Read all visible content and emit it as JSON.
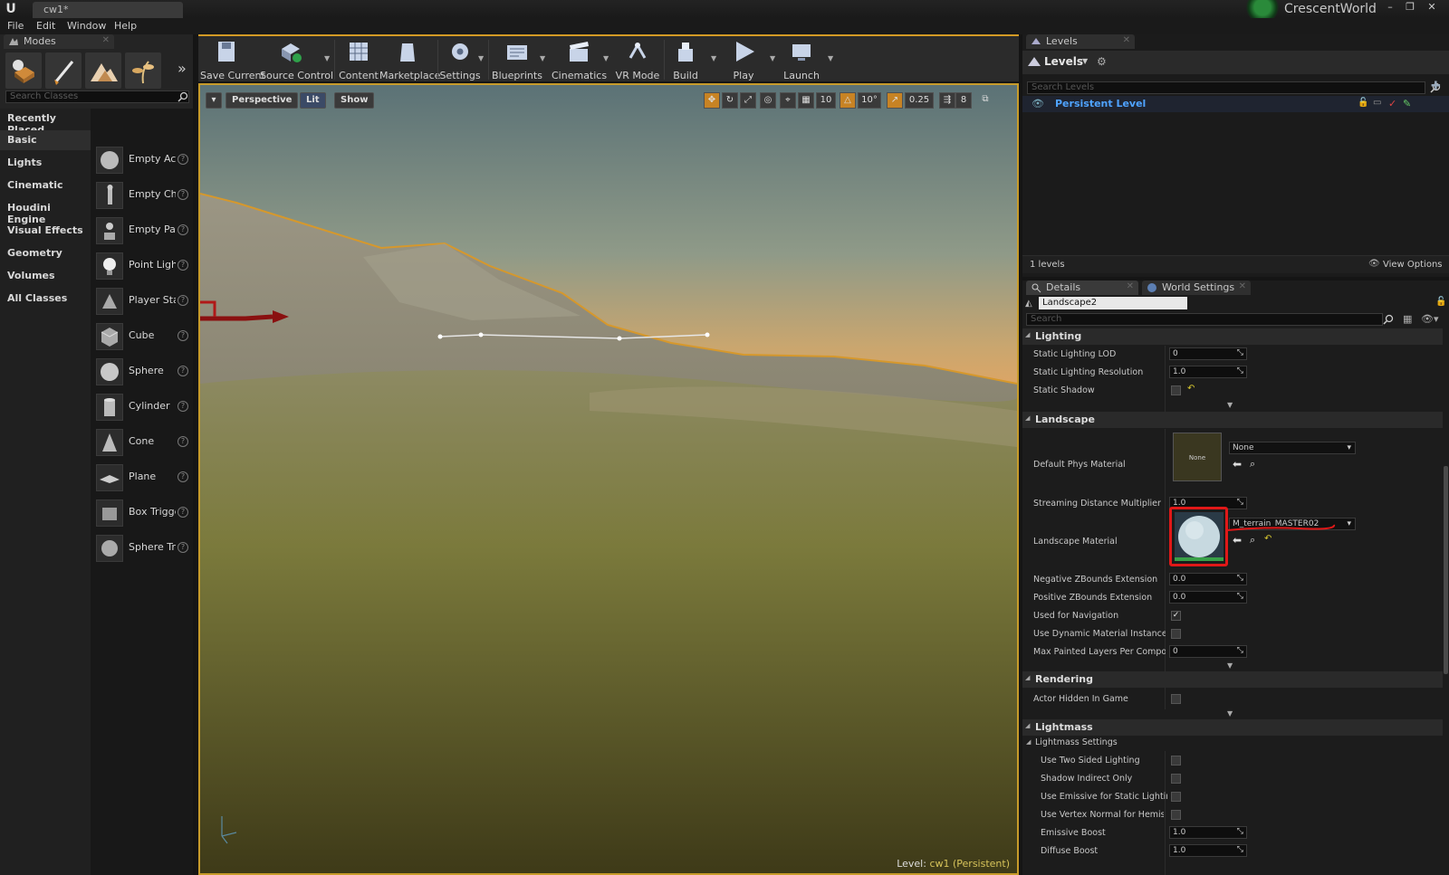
{
  "window": {
    "doc_tab": "cw1*",
    "brand": "CrescentWorld",
    "controls": [
      "–",
      "❐",
      "✕"
    ]
  },
  "menu": [
    "File",
    "Edit",
    "Window",
    "Help"
  ],
  "modes": {
    "tab": "Modes",
    "search_placeholder": "Search Classes",
    "categories": [
      "Recently Placed",
      "Basic",
      "Lights",
      "Cinematic",
      "Houdini Engine",
      "Visual Effects",
      "Geometry",
      "Volumes",
      "All Classes"
    ],
    "active_category": "Basic",
    "items": [
      "Empty Act",
      "Empty Cha",
      "Empty Pav",
      "Point Light",
      "Player Sta",
      "Cube",
      "Sphere",
      "Cylinder",
      "Cone",
      "Plane",
      "Box Trigge",
      "Sphere Tr"
    ],
    "help_glyph": "?"
  },
  "toolbar": {
    "buttons": [
      "Save Current",
      "Source Control",
      "Content",
      "Marketplace",
      "Settings",
      "Blueprints",
      "Cinematics",
      "VR Mode",
      "Build",
      "Play",
      "Launch"
    ]
  },
  "viewport": {
    "perspective": "Perspective",
    "lit": "Lit",
    "show": "Show",
    "grid_snap": "10",
    "rot_snap": "10°",
    "scale_snap": "0.25",
    "cam_speed": "8",
    "level_prefix": "Level:",
    "level_name": "cw1 (Persistent)"
  },
  "levels": {
    "tab": "Levels",
    "header": "Levels",
    "search_placeholder": "Search Levels",
    "persistent": "Persistent Level",
    "count": "1 levels",
    "view_options": "View Options"
  },
  "details": {
    "tab_details": "Details",
    "tab_world": "World Settings",
    "actor_name": "Landscape2",
    "search_placeholder": "Search",
    "sections": {
      "lighting": "Lighting",
      "landscape": "Landscape",
      "rendering": "Rendering",
      "lightmass": "Lightmass",
      "lightmass_settings": "Lightmass Settings"
    },
    "lighting": {
      "static_lod_label": "Static Lighting LOD",
      "static_lod": "0",
      "static_res_label": "Static Lighting Resolution",
      "static_res": "1.0",
      "static_shadow_label": "Static Shadow"
    },
    "landscape": {
      "phys_label": "Default Phys Material",
      "phys_thumb": "None",
      "phys_value": "None",
      "stream_label": "Streaming Distance Multiplier",
      "stream": "1.0",
      "material_label": "Landscape Material",
      "material_value": "M_terrain_MASTER02",
      "negz_label": "Negative ZBounds Extension",
      "negz": "0.0",
      "posz_label": "Positive ZBounds Extension",
      "posz": "0.0",
      "nav_label": "Used for Navigation",
      "dyn_label": "Use Dynamic Material Instance",
      "maxlayers_label": "Max Painted Layers Per Componen",
      "maxlayers": "0"
    },
    "rendering": {
      "hidden_label": "Actor Hidden In Game"
    },
    "lightmass": {
      "two_sided": "Use Two Sided Lighting",
      "shadow_indirect": "Shadow Indirect Only",
      "emissive_static": "Use Emissive for Static Lighting",
      "vertex_normal": "Use Vertex Normal for Hemisphe",
      "emissive_boost_label": "Emissive Boost",
      "emissive_boost": "1.0",
      "diffuse_boost_label": "Diffuse Boost",
      "diffuse_boost": "1.0"
    }
  },
  "colors": {
    "accent": "#d39a25",
    "persistent_level": "#4fa3ff",
    "annotation_red": "#e01818"
  }
}
